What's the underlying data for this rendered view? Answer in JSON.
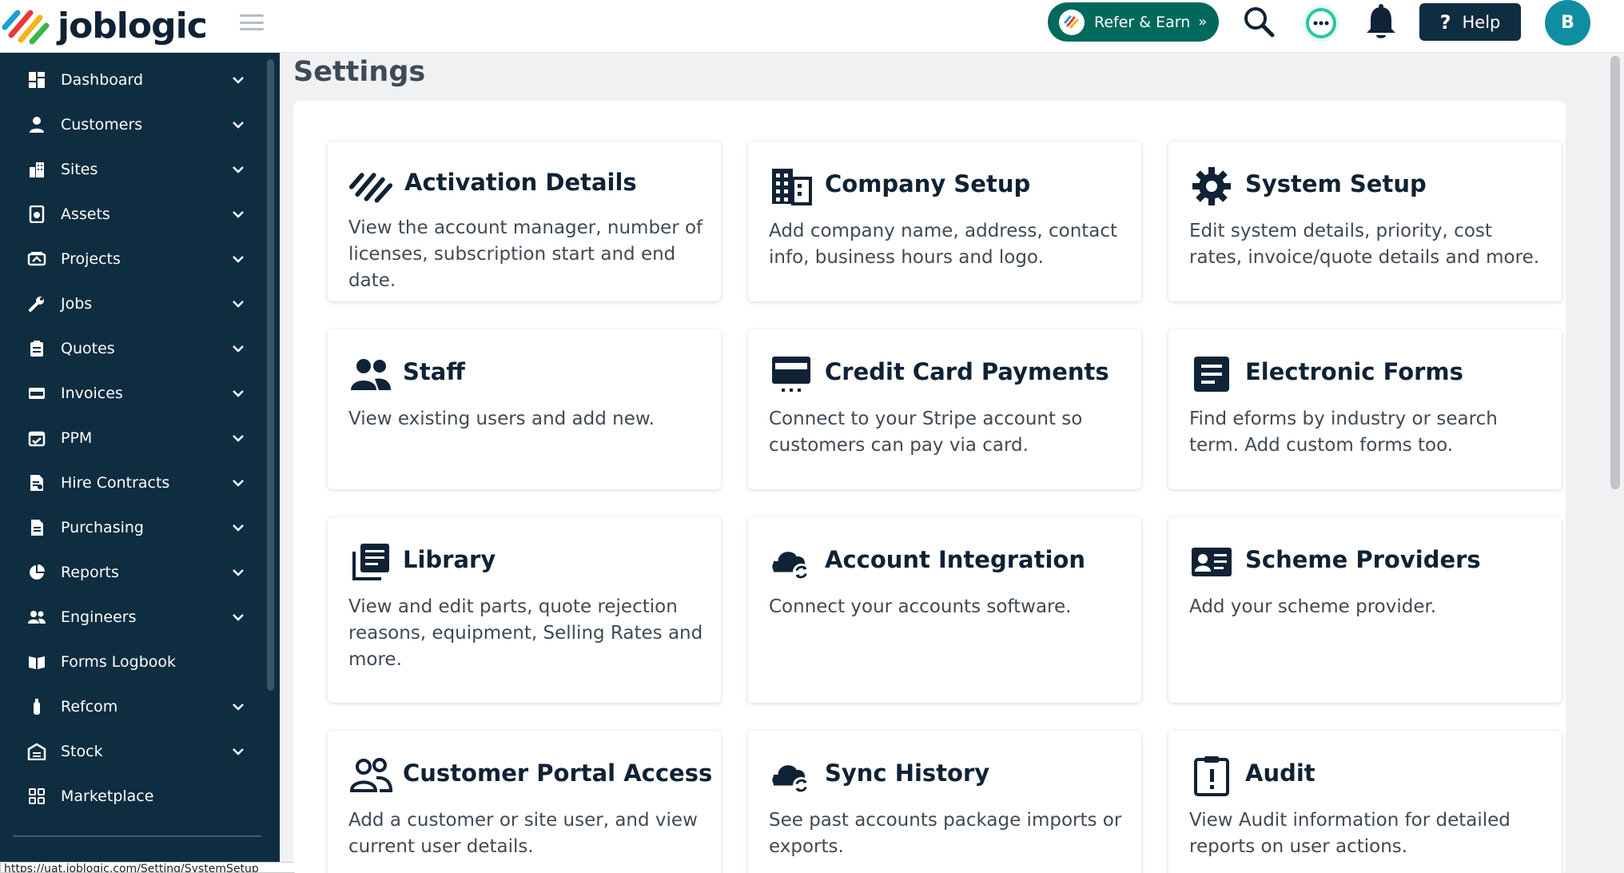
{
  "brand": {
    "name": "joblogic"
  },
  "topbar": {
    "refer_label": "Refer & Earn",
    "help_label": "Help",
    "avatar_initial": "B"
  },
  "sidebar": {
    "items": [
      {
        "label": "Dashboard",
        "icon": "dashboard-icon",
        "has_chevron": true
      },
      {
        "label": "Customers",
        "icon": "person-icon",
        "has_chevron": true
      },
      {
        "label": "Sites",
        "icon": "buildings-icon",
        "has_chevron": true
      },
      {
        "label": "Assets",
        "icon": "asset-tag-icon",
        "has_chevron": true
      },
      {
        "label": "Projects",
        "icon": "projects-icon",
        "has_chevron": true
      },
      {
        "label": "Jobs",
        "icon": "wrench-icon",
        "has_chevron": true
      },
      {
        "label": "Quotes",
        "icon": "clipboard-icon",
        "has_chevron": true
      },
      {
        "label": "Invoices",
        "icon": "card-icon",
        "has_chevron": true
      },
      {
        "label": "PPM",
        "icon": "calendar-check-icon",
        "has_chevron": true
      },
      {
        "label": "Hire Contracts",
        "icon": "contract-icon",
        "has_chevron": true
      },
      {
        "label": "Purchasing",
        "icon": "document-icon",
        "has_chevron": true
      },
      {
        "label": "Reports",
        "icon": "pie-chart-icon",
        "has_chevron": true
      },
      {
        "label": "Engineers",
        "icon": "people-icon",
        "has_chevron": true
      },
      {
        "label": "Forms Logbook",
        "icon": "book-icon",
        "has_chevron": false
      },
      {
        "label": "Refcom",
        "icon": "cylinder-icon",
        "has_chevron": true
      },
      {
        "label": "Stock",
        "icon": "warehouse-icon",
        "has_chevron": true
      },
      {
        "label": "Marketplace",
        "icon": "grid-icon",
        "has_chevron": false
      }
    ]
  },
  "status_bar": {
    "url": "https://uat.joblogic.com/Setting/SystemSetup"
  },
  "main": {
    "title": "Settings",
    "cards": [
      {
        "title": "Activation Details",
        "desc": "View the account manager, number of licenses, subscription start and end date.",
        "icon": "joblogic-icon"
      },
      {
        "title": "Company Setup",
        "desc": "Add company name, address, contact info, business hours and logo.",
        "icon": "building-icon"
      },
      {
        "title": "System Setup",
        "desc": "Edit system details, priority, cost rates, invoice/quote details and more.",
        "icon": "gear-icon"
      },
      {
        "title": "Staff",
        "desc": "View existing users and add new.",
        "icon": "people-icon"
      },
      {
        "title": "Credit Card Payments",
        "desc": "Connect to your Stripe account so customers can pay via card.",
        "icon": "credit-card-icon"
      },
      {
        "title": "Electronic Forms",
        "desc": "Find eforms by industry or search term. Add custom forms too.",
        "icon": "form-icon"
      },
      {
        "title": "Library",
        "desc": "View and edit parts, quote rejection reasons, equipment, Selling Rates and more.",
        "icon": "library-icon"
      },
      {
        "title": "Account Integration",
        "desc": "Connect your accounts software.",
        "icon": "cloud-sync-icon"
      },
      {
        "title": "Scheme Providers",
        "desc": "Add your scheme provider.",
        "icon": "id-card-icon"
      },
      {
        "title": "Customer Portal Access",
        "desc": "Add a customer or site user, and view current user details.",
        "icon": "people-outline-icon"
      },
      {
        "title": "Sync History",
        "desc": "See past accounts package imports or exports.",
        "icon": "cloud-sync-icon"
      },
      {
        "title": "Audit",
        "desc": "View Audit information for detailed reports on user actions.",
        "icon": "clipboard-alert-icon"
      }
    ]
  },
  "colors": {
    "sidebar_bg": "#0f2d40",
    "refer_bg": "#00695c",
    "help_bg": "#0f2d40",
    "avatar_bg": "#0f8ea1",
    "title_text": "#0f2236"
  }
}
